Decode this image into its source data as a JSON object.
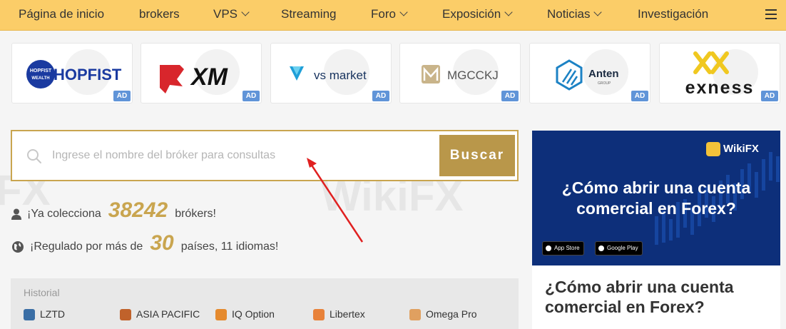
{
  "nav": {
    "items": [
      {
        "label": "Página de inicio",
        "dropdown": false
      },
      {
        "label": "brokers",
        "dropdown": false
      },
      {
        "label": "VPS",
        "dropdown": true
      },
      {
        "label": "Streaming",
        "dropdown": false
      },
      {
        "label": "Foro",
        "dropdown": true
      },
      {
        "label": "Exposición",
        "dropdown": true
      },
      {
        "label": "Noticias",
        "dropdown": true
      },
      {
        "label": "Investigación",
        "dropdown": false
      }
    ],
    "menu_icon": "hamburger-menu-icon",
    "background": "#fbcd68"
  },
  "ads": [
    {
      "name": "HOPFIST",
      "badge": "AD",
      "logo_sub": "HOPFIST WEALTH"
    },
    {
      "name": "XM",
      "badge": "AD"
    },
    {
      "name": "vs market",
      "badge": "AD"
    },
    {
      "name": "MGCCKJ",
      "badge": "AD"
    },
    {
      "name": "Anten",
      "badge": "AD",
      "logo_sub": "GROUP"
    },
    {
      "name": "exness",
      "badge": "AD"
    }
  ],
  "search": {
    "placeholder": "Ingrese el nombre del bróker para consultas",
    "value": "",
    "button_label": "Buscar",
    "icon": "search-icon"
  },
  "stats": {
    "line1_prefix": "¡Ya colecciona",
    "line1_value": "38242",
    "line1_suffix": "brókers!",
    "line2_prefix": "¡Regulado por más de",
    "line2_value": "30",
    "line2_suffix": "países, 11 idiomas!"
  },
  "history": {
    "title": "Historial",
    "items": [
      {
        "label": "LZTD",
        "color": "#3a6ea5"
      },
      {
        "label": "ASIA PACIFIC",
        "color": "#c0622b"
      },
      {
        "label": "IQ Option",
        "color": "#e58a2e"
      },
      {
        "label": "Libertex",
        "color": "#e8823a"
      },
      {
        "label": "Omega Pro",
        "color": "#e0a060"
      }
    ]
  },
  "banner": {
    "brand": "WikiFX",
    "title": "¿Cómo abrir una cuenta comercial en Forex?",
    "store_badges": [
      "App Store",
      "Google Play"
    ]
  },
  "article": {
    "title": "¿Cómo abrir una cuenta comercial en Forex?"
  },
  "watermark": "WikiFX",
  "colors": {
    "accent_gold": "#c9a54f",
    "button_gold": "#b9974a",
    "ad_badge": "#6094d8",
    "banner_bg": "#0d2f7a",
    "arrow": "#e02020"
  }
}
